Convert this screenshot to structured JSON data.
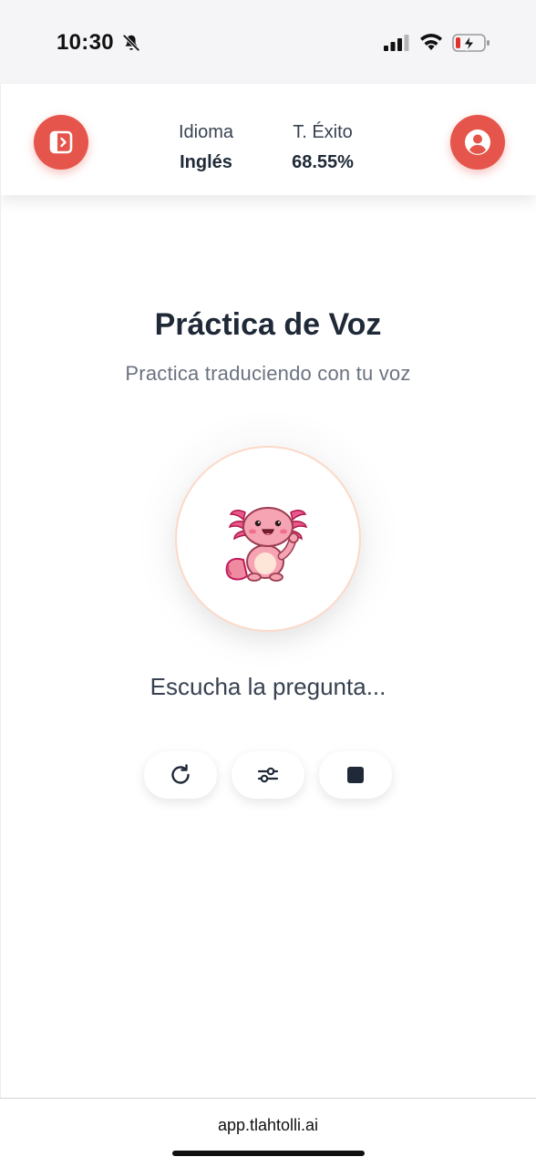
{
  "status_bar": {
    "time": "10:30",
    "icons": [
      "bell-slash-icon",
      "cellular-signal-icon",
      "wifi-icon",
      "battery-charging-icon"
    ]
  },
  "header": {
    "menu_icon": "panel-toggle-icon",
    "profile_icon": "user-circle-icon",
    "language": {
      "label": "Idioma",
      "value": "Inglés"
    },
    "success_rate": {
      "label": "T. Éxito",
      "value": "68.55%"
    }
  },
  "main": {
    "title": "Práctica de Voz",
    "subtitle": "Practica traduciendo con tu voz",
    "mascot": "axolotl-mascot",
    "status": "Escucha la pregunta...",
    "controls": [
      {
        "icon": "replay-icon"
      },
      {
        "icon": "sliders-icon"
      },
      {
        "icon": "stop-icon"
      }
    ]
  },
  "browser": {
    "url": "app.tlahtolli.ai"
  },
  "colors": {
    "accent": "#e5554b",
    "title": "#1f2937",
    "subtitle": "#6b7280",
    "avatar_border": "#fcd9c8"
  }
}
